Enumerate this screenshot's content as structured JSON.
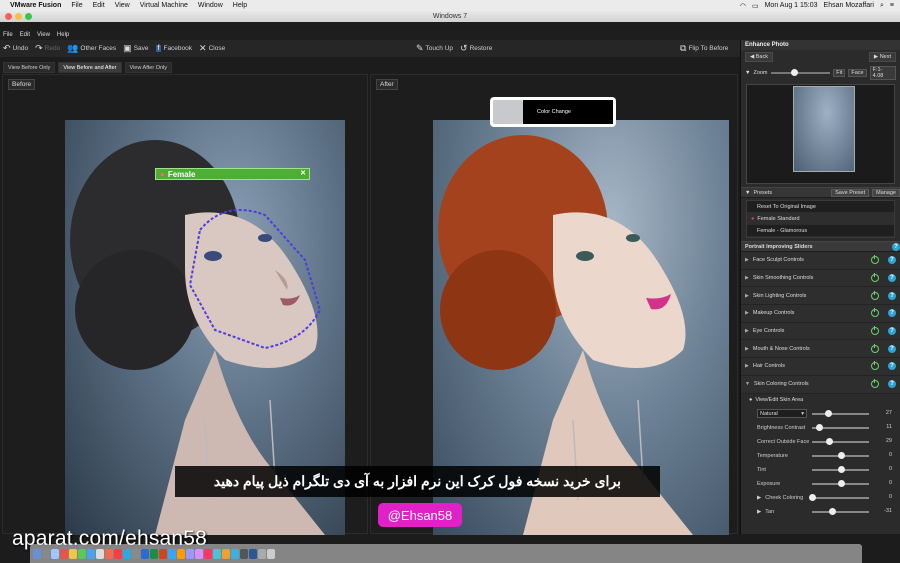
{
  "mac": {
    "app": "VMware Fusion",
    "menus": [
      "File",
      "Edit",
      "View",
      "Virtual Machine",
      "Window",
      "Help"
    ],
    "clock": "Mon Aug 1  15:03",
    "user": "Ehsan Mozaffari"
  },
  "window": {
    "title": "Windows 7"
  },
  "app_menu": [
    "File",
    "Edit",
    "View",
    "Help"
  ],
  "toolbar": {
    "undo": "Undo",
    "redo": "Redo",
    "other_faces": "Other Faces",
    "save": "Save",
    "facebook": "Facebook",
    "close": "Close",
    "touch_up": "Touch Up",
    "restore": "Restore",
    "flip": "Flip To Before"
  },
  "view_tabs": [
    "View Before Only",
    "View Before and After",
    "View After Only"
  ],
  "panes": {
    "before_label": "Before",
    "after_label": "After"
  },
  "face_tag": "Female",
  "color_change": "Color Change",
  "caption": "برای خرید نسخه فول کرک این نرم افزار به آی دی تلگرام ذیل پیام دهید",
  "handle": "@Ehsan58",
  "watermark": "aparat.com/ehsan58",
  "panel": {
    "title": "Enhance Photo",
    "back": "Back",
    "next": "Next",
    "zoom": "Zoom",
    "fit": "Fit",
    "face": "Face",
    "zoom_level": "F:1-4.08",
    "presets_label": "Presets",
    "save_preset": "Save Preset",
    "manage": "Manage",
    "presets": [
      "Reset To Original Image",
      "Female Standard",
      "Female - Glamorous"
    ],
    "sliders_title": "Portrait Improving Sliders",
    "controls": [
      "Face Sculpt Controls",
      "Skin Smoothing Controls",
      "Skin Lighting Controls",
      "Makeup Controls",
      "Eye Controls",
      "Mouth & Nose Controls",
      "Hair Controls",
      "Skin Coloring Controls"
    ],
    "view_edit_skin": "View/Edit Skin Area",
    "skin_mode": "Natural",
    "sliders": [
      {
        "label": "",
        "value": "27",
        "pos": 0.28
      },
      {
        "label": "Brightness Contrast",
        "value": "11",
        "pos": 0.12
      },
      {
        "label": "Correct Outside Face",
        "value": "29",
        "pos": 0.3
      },
      {
        "label": "Temperature",
        "value": "0",
        "pos": 0.5
      },
      {
        "label": "Tint",
        "value": "0",
        "pos": 0.5
      },
      {
        "label": "Exposure",
        "value": "0",
        "pos": 0.5
      },
      {
        "label": "Cheek Coloring",
        "value": "0",
        "pos": 0.0
      },
      {
        "label": "Tan",
        "value": "-31",
        "pos": 0.35
      }
    ]
  }
}
